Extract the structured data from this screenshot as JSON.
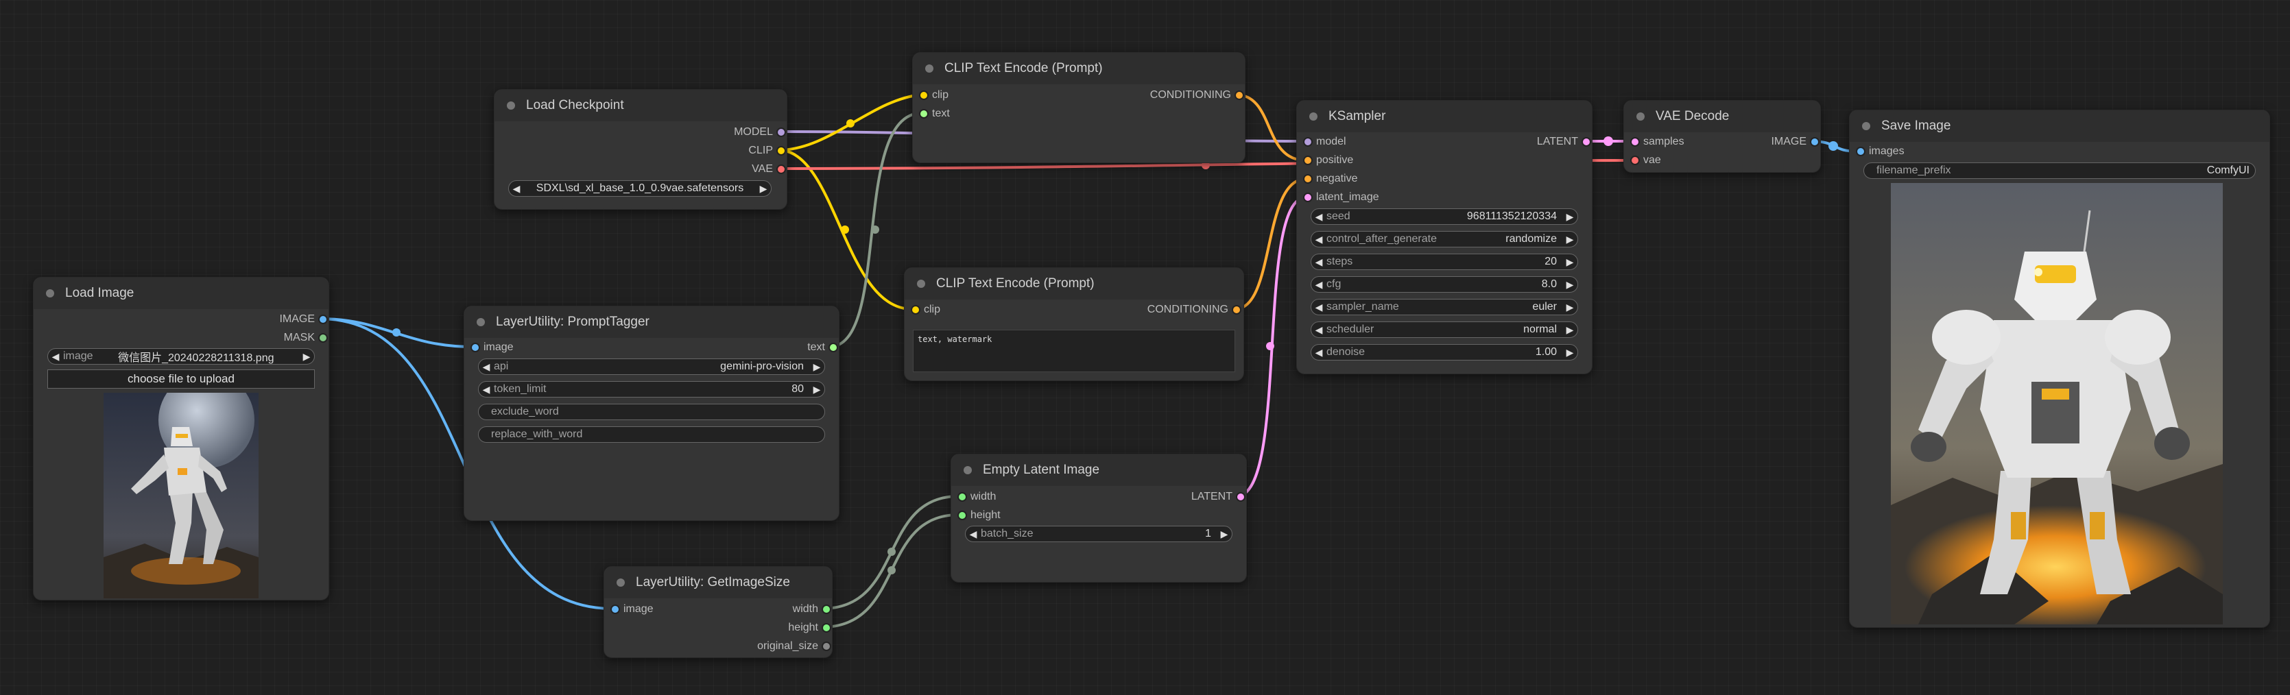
{
  "colors": {
    "model": "#b39ddb",
    "clip": "#ffd500",
    "vae": "#ff6e6e",
    "conditioning": "#ffa931",
    "latent": "#ff9cf9",
    "image": "#64b5f6",
    "int": "#7ff07f",
    "string": "#a1ff8a",
    "mask": "#81c784"
  },
  "nodes": {
    "load_checkpoint": {
      "title": "Load Checkpoint",
      "outputs": [
        "MODEL",
        "CLIP",
        "VAE"
      ],
      "ckpt_name": "SDXL\\sd_xl_base_1.0_0.9vae.safetensors"
    },
    "clip_top": {
      "title": "CLIP Text Encode (Prompt)",
      "inputs": [
        "clip",
        "text"
      ],
      "output": "CONDITIONING"
    },
    "clip_bottom": {
      "title": "CLIP Text Encode (Prompt)",
      "inputs": [
        "clip"
      ],
      "output": "CONDITIONING",
      "text": "text, watermark"
    },
    "ksampler": {
      "title": "KSampler",
      "inputs": [
        "model",
        "positive",
        "negative",
        "latent_image"
      ],
      "output": "LATENT",
      "widgets": [
        {
          "label": "seed",
          "value": "968111352120334"
        },
        {
          "label": "control_after_generate",
          "value": "randomize"
        },
        {
          "label": "steps",
          "value": "20"
        },
        {
          "label": "cfg",
          "value": "8.0"
        },
        {
          "label": "sampler_name",
          "value": "euler"
        },
        {
          "label": "scheduler",
          "value": "normal"
        },
        {
          "label": "denoise",
          "value": "1.00"
        }
      ]
    },
    "vae_decode": {
      "title": "VAE Decode",
      "inputs": [
        "samples",
        "vae"
      ],
      "output": "IMAGE"
    },
    "save_image": {
      "title": "Save Image",
      "inputs": [
        "images"
      ],
      "filename_prefix_label": "filename_prefix",
      "filename_prefix": "ComfyUI"
    },
    "load_image": {
      "title": "Load Image",
      "outputs": [
        "IMAGE",
        "MASK"
      ],
      "image_label": "image",
      "image": "微信图片_20240228211318.png",
      "upload_button": "choose file to upload"
    },
    "prompt_tagger": {
      "title": "LayerUtility: PromptTagger",
      "inputs": [
        "image"
      ],
      "output": "text",
      "api_label": "api",
      "api": "gemini-pro-vision",
      "token_limit_label": "token_limit",
      "token_limit": "80",
      "exclude_word": "exclude_word",
      "replace_with_word": "replace_with_word"
    },
    "get_image_size": {
      "title": "LayerUtility: GetImageSize",
      "inputs": [
        "image"
      ],
      "outputs": [
        "width",
        "height",
        "original_size"
      ]
    },
    "empty_latent": {
      "title": "Empty Latent Image",
      "inputs": [
        "width",
        "height"
      ],
      "output": "LATENT",
      "batch_size_label": "batch_size",
      "batch_size": "1"
    }
  }
}
